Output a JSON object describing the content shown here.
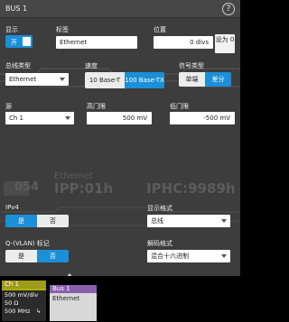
{
  "title": "BUS 1",
  "help_icon": "question-icon",
  "display": {
    "label": "显示",
    "toggle_text": "开",
    "on": true
  },
  "tag": {
    "label": "标签",
    "value": "Ethernet"
  },
  "position": {
    "label": "位置",
    "value": "0 divs",
    "set_zero": "设为 0"
  },
  "bus_type": {
    "label": "总线类型",
    "value": "Ethernet"
  },
  "speed": {
    "label": "速度",
    "options": [
      "10 Base-T",
      "100 Base-TX"
    ],
    "selected": 1
  },
  "signal_type": {
    "label": "信号类型",
    "options": [
      "单端",
      "差分"
    ],
    "selected": 1
  },
  "source": {
    "label": "源",
    "value": "Ch 1"
  },
  "high_threshold": {
    "label": "高门限",
    "value": "500 mV"
  },
  "low_threshold": {
    "label": "低门限",
    "value": "-500 mV"
  },
  "decode_overlay": {
    "protocol": "Ethernet",
    "left": "054",
    "mid": "IPP:01h",
    "right": "IPHC:9989h"
  },
  "ipv4": {
    "label": "IPv4",
    "options": [
      "是",
      "否"
    ],
    "selected": 0
  },
  "display_format": {
    "label": "显示格式",
    "value": "总线"
  },
  "qvlan": {
    "label": "Q-(VLAN) 标记",
    "options": [
      "是",
      "否"
    ],
    "selected": 1
  },
  "decode_format": {
    "label": "解码格式",
    "value": "混合十六进制"
  },
  "channel_badge": {
    "name": "Ch 1",
    "scale": "500 mV/div",
    "impedance": "50 Ω",
    "bandwidth": "500 MHz"
  },
  "bus_badge": {
    "name": "Bus 1",
    "protocol": "Ethernet"
  },
  "colors": {
    "accent": "#1b8fd8",
    "panel": "#3d3d3d",
    "channel": "#b0b000",
    "bus": "#8a5fb0"
  }
}
